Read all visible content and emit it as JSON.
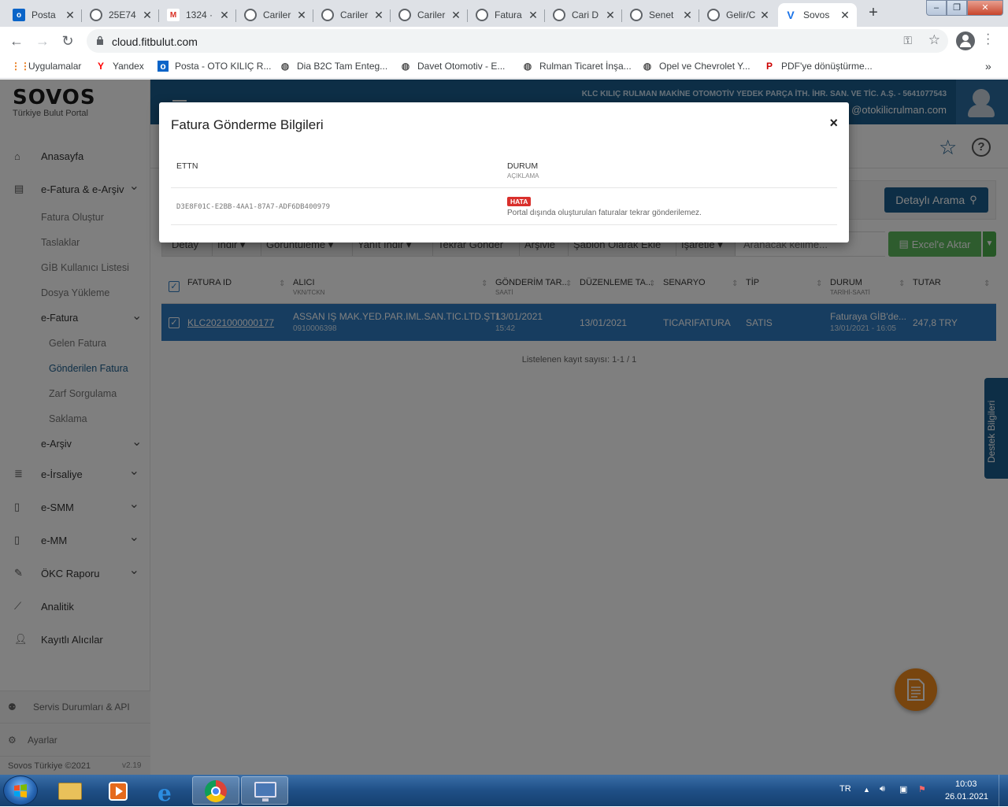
{
  "browser": {
    "tabs": [
      {
        "label": "Posta",
        "icon": "outlook-icon",
        "color": "#0a64c8"
      },
      {
        "label": "25E74",
        "icon": "globe-icon",
        "color": "#5f6368"
      },
      {
        "label": "1324 ·",
        "icon": "gmail-icon",
        "color": "#d93025"
      },
      {
        "label": "Cariler",
        "icon": "globe-icon",
        "color": "#5f6368"
      },
      {
        "label": "Cariler",
        "icon": "globe-icon",
        "color": "#5f6368"
      },
      {
        "label": "Cariler",
        "icon": "globe-icon",
        "color": "#5f6368"
      },
      {
        "label": "Fatura",
        "icon": "globe-icon",
        "color": "#5f6368"
      },
      {
        "label": "Cari D",
        "icon": "globe-icon",
        "color": "#5f6368"
      },
      {
        "label": "Senet",
        "icon": "globe-icon",
        "color": "#5f6368"
      },
      {
        "label": "Gelir/C",
        "icon": "globe-icon",
        "color": "#5f6368"
      },
      {
        "label": "Sovos",
        "icon": "sovos-icon",
        "color": "#1a73e8"
      }
    ],
    "url": "cloud.fitbulut.com",
    "bookmarks": [
      {
        "label": "Uygulamalar",
        "icon": "apps-grid-icon"
      },
      {
        "label": "Yandex",
        "icon": "yandex-icon"
      },
      {
        "label": "Posta - OTO KILIÇ R...",
        "icon": "outlook-icon"
      },
      {
        "label": "Dia B2C Tam Enteg...",
        "icon": "globe-icon"
      },
      {
        "label": "Davet Otomotiv - E...",
        "icon": "globe-icon"
      },
      {
        "label": "Rulman Ticaret İnşa...",
        "icon": "globe-icon"
      },
      {
        "label": "Opel ve Chevrolet Y...",
        "icon": "globe-icon"
      },
      {
        "label": "PDF'ye dönüştürme...",
        "icon": "pdf24-icon"
      }
    ],
    "more_bookmarks": "»"
  },
  "sidebar": {
    "logo": "SOVOS",
    "logo_sub": "Türkiye Bulut Portal",
    "nav": [
      {
        "label": "Anasayfa",
        "icon": "home-icon"
      },
      {
        "label": "e-Fatura & e-Arşiv",
        "icon": "document-icon"
      },
      {
        "label": "e-İrsaliye",
        "icon": "list-icon"
      },
      {
        "label": "e-SMM",
        "icon": "file-icon"
      },
      {
        "label": "e-MM",
        "icon": "file-icon"
      },
      {
        "label": "ÖKC Raporu",
        "icon": "edit-icon"
      },
      {
        "label": "Analitik",
        "icon": "chart-icon"
      },
      {
        "label": "Kayıtlı Alıcılar",
        "icon": "user-icon"
      }
    ],
    "sub": [
      "Fatura Oluştur",
      "Taslaklar",
      "GİB Kullanıcı Listesi",
      "Dosya Yükleme",
      "e-Fatura",
      "e-Arşiv"
    ],
    "sub2": [
      "Gelen Fatura",
      "Gönderilen Fatura",
      "Zarf Sorgulama",
      "Saklama"
    ],
    "servis": "Servis Durumları & API",
    "ayarlar": "Ayarlar",
    "footer": "Sovos Türkiye ©2021",
    "version": "v2.19"
  },
  "header": {
    "company": "KLC KILIÇ RULMAN MAKİNE OTOMOTİV YEDEK PARÇA İTH. İHR. SAN. VE TİC. A.Ş. - 5641077543",
    "email": "@otokilicrulman.com"
  },
  "content": {
    "detayli_arama": "Detaylı Arama",
    "toolbar": [
      "Detay",
      "İndir",
      "Görüntüleme",
      "Yanıt İndir",
      "Tekrar Gönder",
      "Arşivle",
      "Şablon Olarak Ekle",
      "İşaretle"
    ],
    "search_placeholder": "Aranacak kelime...",
    "excel": "Excel'e Aktar",
    "columns": [
      {
        "label": "FATURA ID",
        "sub": ""
      },
      {
        "label": "ALICI",
        "sub": "VKN/TCKN"
      },
      {
        "label": "GÖNDERİM TAR...",
        "sub": "SAATİ"
      },
      {
        "label": "DÜZENLEME TA...",
        "sub": ""
      },
      {
        "label": "SENARYO",
        "sub": ""
      },
      {
        "label": "TİP",
        "sub": ""
      },
      {
        "label": "DURUM",
        "sub": "TARİHİ-SAATİ"
      },
      {
        "label": "TUTAR",
        "sub": ""
      }
    ],
    "row": {
      "fatura_id": "KLC2021000000177",
      "alici": "ASSAN IŞ MAK.YED.PAR.IML.SAN.TIC.LTD.ŞTI.",
      "vkn": "0910006398",
      "gonderim_tarih": "13/01/2021",
      "gonderim_saat": "15:42",
      "duzenleme": "13/01/2021",
      "senaryo": "TICARIFATURA",
      "tip": "SATIS",
      "durum": "Faturaya GİB'de...",
      "durum_tarih": "13/01/2021 - 16:05",
      "tutar": "247,8 TRY"
    },
    "count": "Listelenen kayıt sayısı: 1-1 / 1",
    "destek": "Destek Bilgileri"
  },
  "modal": {
    "title": "Fatura Gönderme Bilgileri",
    "close": "×",
    "col_ettn": "ETTN",
    "col_durum": "DURUM",
    "col_aciklama": "AÇIKLAMA",
    "ettn": "D3E8F01C-E2BB-4AA1-87A7-ADF6DB400979",
    "badge": "HATA",
    "aciklama": "Portal dışında oluşturulan faturalar tekrar gönderilemez."
  },
  "taskbar": {
    "lang": "TR",
    "time": "10:03",
    "date": "26.01.2021"
  },
  "colors": {
    "header": "#1a5c8d",
    "selected_row": "#2e7bc0",
    "excel": "#5cb85c",
    "error": "#d9302c",
    "fab": "#f08a1c"
  }
}
